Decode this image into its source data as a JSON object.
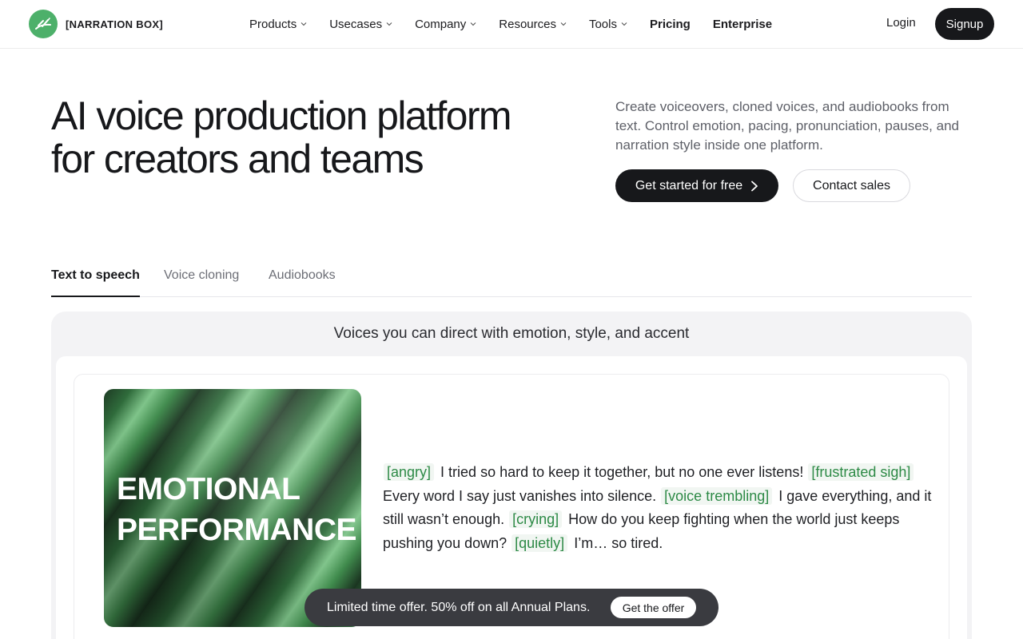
{
  "brand": {
    "name": "[NARRATION BOX]",
    "accent": "#4db06a"
  },
  "nav": {
    "items": [
      {
        "label": "Products",
        "has_dropdown": true
      },
      {
        "label": "Usecases",
        "has_dropdown": true
      },
      {
        "label": "Company",
        "has_dropdown": true
      },
      {
        "label": "Resources",
        "has_dropdown": true
      },
      {
        "label": "Tools",
        "has_dropdown": true
      },
      {
        "label": "Pricing",
        "has_dropdown": false
      },
      {
        "label": "Enterprise",
        "has_dropdown": false
      }
    ],
    "login_label": "Login",
    "signup_label": "Signup"
  },
  "hero": {
    "title_line1": "AI voice production platform",
    "title_line2": "for creators and teams",
    "subtitle": "Create voiceovers, cloned voices, and audiobooks from text. Control emotion, pacing, pronunciation, pauses, and narration style inside one platform.",
    "primary_cta": "Get started for free",
    "secondary_cta": "Contact sales"
  },
  "tabs": [
    {
      "label": "Text to speech",
      "active": true
    },
    {
      "label": "Voice cloning",
      "active": false
    },
    {
      "label": "Audiobooks",
      "active": false
    }
  ],
  "panel": {
    "heading": "Voices you can direct with emotion, style, and accent",
    "art_title_line1": "EMOTIONAL",
    "art_title_line2": "PERFORMANCE",
    "segments": [
      {
        "tag": "[angry]",
        "text": "I tried so hard to keep it together, but no one ever listens!"
      },
      {
        "tag": "[frustrated sigh]",
        "text": "Every word I say just vanishes into silence."
      },
      {
        "tag": "[voice trembling]",
        "text": "I gave everything, and it still wasn’t enough."
      },
      {
        "tag": "[crying]",
        "text": "How do you keep fighting when the world just keeps pushing you down?"
      },
      {
        "tag": "[quietly]",
        "text": "I’m… so tired."
      }
    ]
  },
  "offer": {
    "text": "Limited time offer. 50% off on all Annual Plans.",
    "button_label": "Get the offer"
  }
}
